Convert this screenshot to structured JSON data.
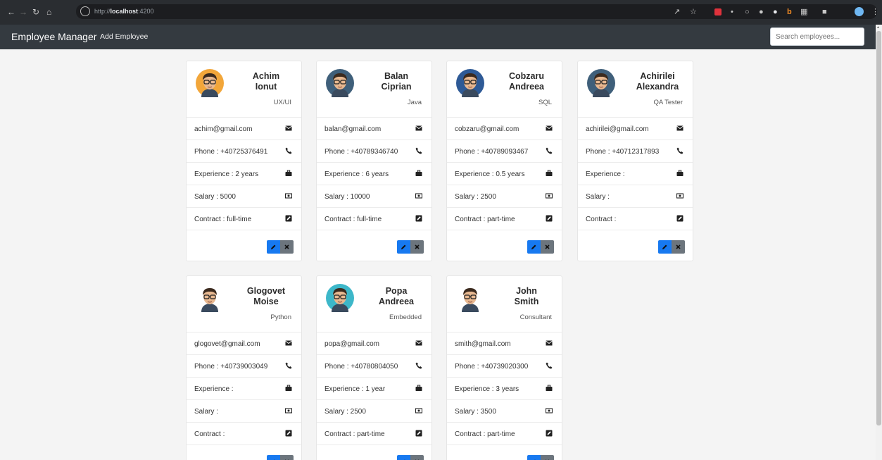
{
  "browser": {
    "url_prefix": "http://",
    "url_host": "localhost",
    "url_port": ":4200"
  },
  "navbar": {
    "brand": "Employee Manager",
    "add_link": "Add Employee",
    "search_placeholder": "Search employees..."
  },
  "employees": [
    {
      "first": "Achim",
      "last": "Ionut",
      "role": "UX/UI",
      "email": "achim@gmail.com",
      "phone": "Phone : +40725376491",
      "experience": "Experience : 2 years",
      "salary": "Salary : 5000",
      "contract": "Contract : full-time",
      "avatar_color": "#f2a63a"
    },
    {
      "first": "Balan",
      "last": "Ciprian",
      "role": "Java",
      "email": "balan@gmail.com",
      "phone": "Phone : +40789346740",
      "experience": "Experience : 6 years",
      "salary": "Salary : 10000",
      "contract": "Contract : full-time",
      "avatar_color": "#3f5f7a"
    },
    {
      "first": "Cobzaru",
      "last": "Andreea",
      "role": "SQL",
      "email": "cobzaru@gmail.com",
      "phone": "Phone : +40789093467",
      "experience": "Experience : 0.5 years",
      "salary": "Salary : 2500",
      "contract": "Contract : part-time",
      "avatar_color": "#2e5a96"
    },
    {
      "first": "Achirilei",
      "last": "Alexandra",
      "role": "QA Tester",
      "email": "achirilei@gmail.com",
      "phone": "Phone : +40712317893",
      "experience": "Experience :",
      "salary": "Salary :",
      "contract": "Contract :",
      "avatar_color": "#3f5f7a"
    },
    {
      "first": "Glogovet",
      "last": "Moise",
      "role": "Python",
      "email": "glogovet@gmail.com",
      "phone": "Phone : +40739003049",
      "experience": "Experience :",
      "salary": "Salary :",
      "contract": "Contract :",
      "avatar_color": "#ffffff"
    },
    {
      "first": "Popa",
      "last": "Andreea",
      "role": "Embedded",
      "email": "popa@gmail.com",
      "phone": "Phone : +40780804050",
      "experience": "Experience : 1 year",
      "salary": "Salary : 2500",
      "contract": "Contract : part-time",
      "avatar_color": "#3db7c9"
    },
    {
      "first": "John",
      "last": "Smith",
      "role": "Consultant",
      "email": "smith@gmail.com",
      "phone": "Phone : +40739020300",
      "experience": "Experience : 3 years",
      "salary": "Salary : 3500",
      "contract": "Contract : part-time",
      "avatar_color": "#ffffff"
    }
  ],
  "icons": {
    "email": "envelope-icon",
    "phone": "phone-icon",
    "experience": "briefcase-icon",
    "salary": "money-icon",
    "contract": "edit-square-icon",
    "edit": "pencil-icon",
    "delete": "times-icon"
  },
  "colors": {
    "navbar_bg": "#343a40",
    "edit_button": "#1779f0",
    "delete_button": "#6c757d",
    "page_bg": "#f4f4f4"
  }
}
